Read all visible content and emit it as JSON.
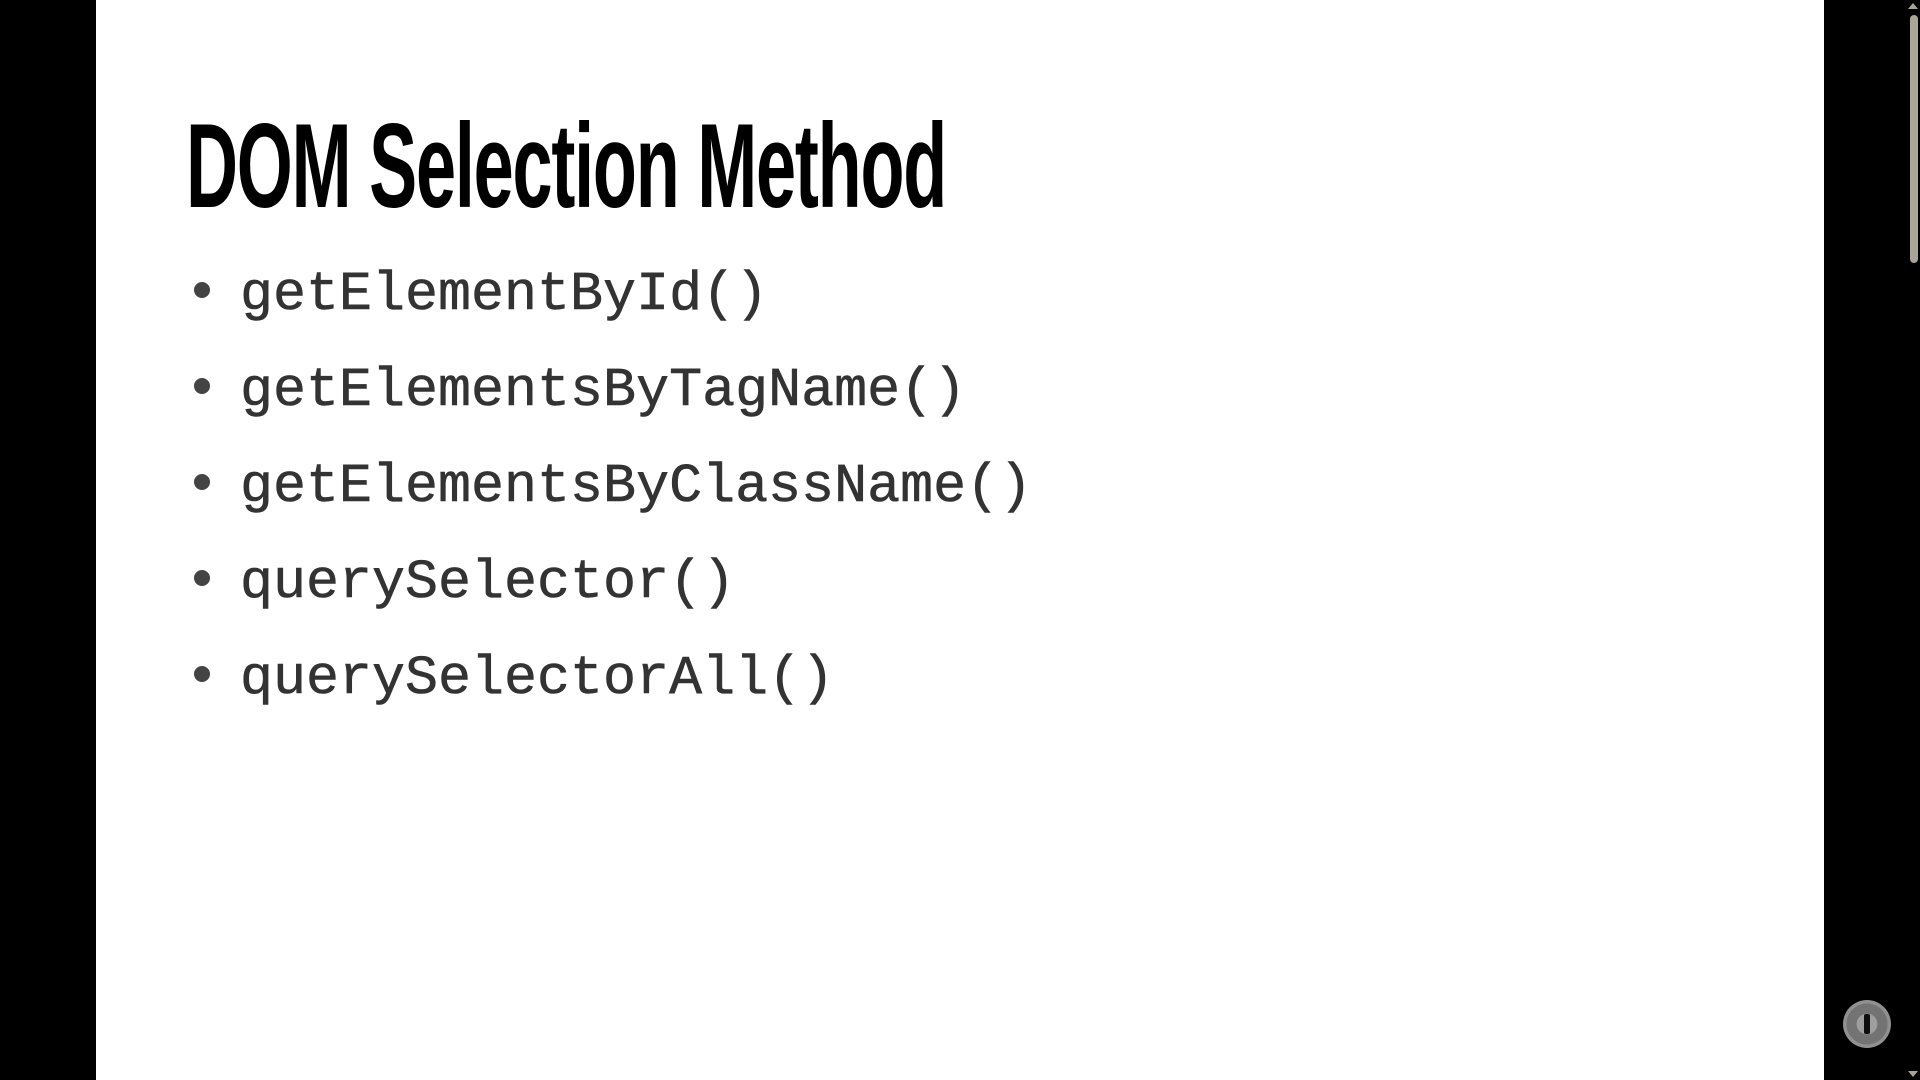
{
  "slide": {
    "title": "DOM Selection Method",
    "bullets": [
      "getElementById()",
      "getElementsByTagName()",
      "getElementsByClassName()",
      "querySelector()",
      "querySelectorAll()"
    ]
  },
  "colors": {
    "background": "#000000",
    "slide": "#ffffff",
    "code_text": "#333333",
    "scrollbar": "#aaa398"
  },
  "icons": {
    "corner_logo": "channel-logo-icon",
    "scroll_up": "arrow-up-icon",
    "scroll_down": "arrow-down-icon"
  }
}
